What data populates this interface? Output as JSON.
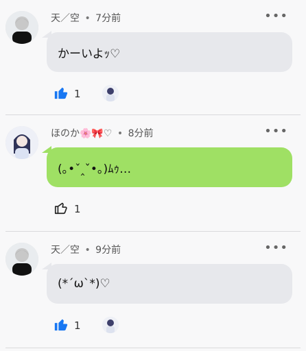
{
  "posts": [
    {
      "author": "天／空",
      "time": "7分前",
      "message": "かーいよｯ♡",
      "likes": "1",
      "liked": true,
      "bubble_color": "#e7e8ec"
    },
    {
      "author": "ほのか🌸🎀♡",
      "time": "8分前",
      "message": "(｡•ˇ‸ˇ•｡)ﾑｩ…",
      "likes": "1",
      "liked": false,
      "bubble_color": "#9fe064"
    },
    {
      "author": "天／空",
      "time": "9分前",
      "message": "(*´ω`*)♡",
      "likes": "1",
      "liked": true,
      "bubble_color": "#e7e8ec"
    }
  ],
  "ui": {
    "meta_separator": "•",
    "more_icon": "more-icon",
    "like_icon": "thumbs-up-icon",
    "accent_color": "#1877f2"
  }
}
